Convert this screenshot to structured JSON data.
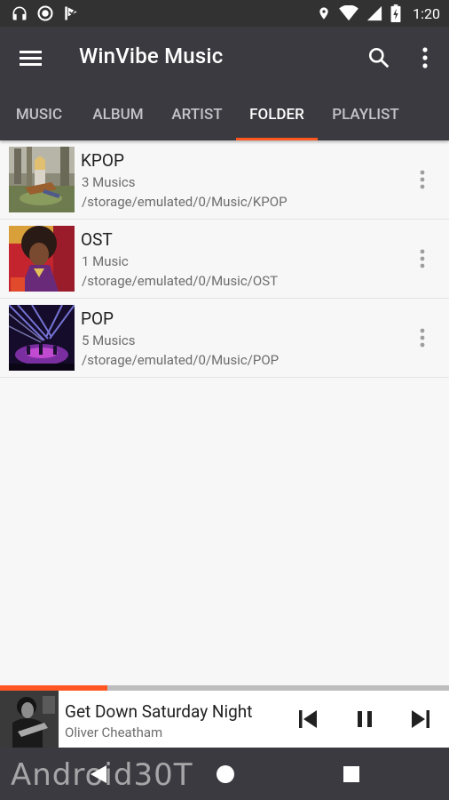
{
  "status_bar": {
    "time": "1:20",
    "icons_left": [
      "headphones-icon",
      "circle-notification-icon",
      "check-flag-icon"
    ],
    "icons_right": [
      "location-icon",
      "wifi-icon",
      "cell-signal-icon",
      "battery-charging-icon"
    ]
  },
  "app_bar": {
    "title": "WinVibe Music",
    "icons": [
      "menu-icon",
      "search-icon",
      "more-vert-icon"
    ]
  },
  "tabs": [
    {
      "label": "MUSIC",
      "active": false
    },
    {
      "label": "ALBUM",
      "active": false
    },
    {
      "label": "ARTIST",
      "active": false
    },
    {
      "label": "FOLDER",
      "active": true
    },
    {
      "label": "PLAYLIST",
      "active": false
    }
  ],
  "folders": [
    {
      "name": "KPOP",
      "count": "3 Musics",
      "path": "/storage/emulated/0/Music/KPOP"
    },
    {
      "name": "OST",
      "count": "1 Music",
      "path": "/storage/emulated/0/Music/OST"
    },
    {
      "name": "POP",
      "count": "5 Musics",
      "path": "/storage/emulated/0/Music/POP"
    }
  ],
  "now_playing": {
    "title": "Get Down Saturday Night",
    "artist": "Oliver Cheatham",
    "progress": 0.24,
    "controls": [
      "skip-previous-icon",
      "pause-icon",
      "skip-next-icon"
    ]
  },
  "nav_bar": {
    "buttons": [
      "back-icon",
      "home-icon",
      "recents-icon"
    ]
  },
  "watermark": "Android30T",
  "colors": {
    "status_bar": "#323232",
    "app_bar": "#3a3a40",
    "accent": "#ff5722",
    "background": "#f7f7f7"
  }
}
